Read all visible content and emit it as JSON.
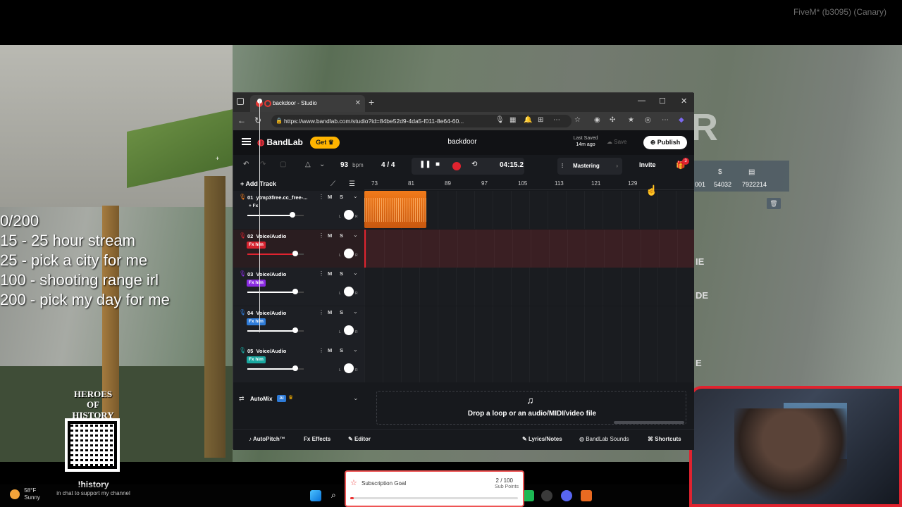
{
  "game": {
    "client_label": "FiveM* (b3095) (Canary)"
  },
  "overlay": {
    "goals": [
      "0/200",
      "15 - 25 hour stream",
      "25 - pick a city for me",
      "100 - shooting range irl",
      "200 - pick my day for me"
    ],
    "heroes_logo": "HEROES OF HISTORY",
    "history_cmd": "!history",
    "history_sub": "in chat to support my channel",
    "weather_temp": "58°F",
    "weather_cond": "Sunny",
    "sub_goal": {
      "title": "Subscription Goal",
      "count": "2 / 100",
      "unit": "Sub Points",
      "progress": 0.02
    }
  },
  "game_hud": {
    "big_letter": "R",
    "values": [
      "001",
      "54032",
      "7922214"
    ],
    "labels": [
      "IE",
      "DE",
      "E"
    ]
  },
  "browser": {
    "tab_title": "backdoor - Studio",
    "url": "https://www.bandlab.com/studio?id=84be52d9-4da5-f011-8e64-60..."
  },
  "bandlab": {
    "brand": "BandLab",
    "get_label": "Get",
    "project_title": "backdoor",
    "last_saved_label": "Last Saved",
    "last_saved_value": "14m ago",
    "save_label": "Save",
    "publish_label": "Publish",
    "bpm_value": "93",
    "bpm_unit": "bpm",
    "time_sig": "4 / 4",
    "time": "04:15.2",
    "mastering_label": "Mastering",
    "invite_label": "Invite",
    "gift_badge": "3",
    "add_track_label": "Add Track",
    "ruler": [
      "73",
      "81",
      "89",
      "97",
      "105",
      "113",
      "121",
      "129"
    ],
    "tracks": [
      {
        "num": "01",
        "name": "ytmp3free.cc_free-...",
        "fx": "+ Fx",
        "fx_color": "#1d1f24",
        "mic_color": "#f07a1a",
        "volume": 0.8
      },
      {
        "num": "02",
        "name": "Voice/Audio",
        "fx": "Fx him",
        "fx_color": "#d8232f",
        "mic_color": "#d8232f",
        "volume": 0.85
      },
      {
        "num": "03",
        "name": "Voice/Audio",
        "fx": "Fx him",
        "fx_color": "#8a2be2",
        "mic_color": "#8a2be2",
        "volume": 0.85
      },
      {
        "num": "04",
        "name": "Voice/Audio",
        "fx": "Fx him",
        "fx_color": "#2e7bd8",
        "mic_color": "#2e7bd8",
        "volume": 0.85
      },
      {
        "num": "05",
        "name": "Voice/Audio",
        "fx": "Fx him",
        "fx_color": "#1aa8a0",
        "mic_color": "#1aa8a0",
        "volume": 0.85
      }
    ],
    "automix_label": "AutoMix",
    "ai_label": "AI",
    "drop_text": "Drop a loop or an audio/MIDI/video file",
    "bottom": {
      "autopitch": "AutoPitch™",
      "effects": "Effects",
      "editor": "Editor",
      "lyrics": "Lyrics/Notes",
      "sounds": "BandLab Sounds",
      "shortcuts": "Shortcuts"
    }
  }
}
